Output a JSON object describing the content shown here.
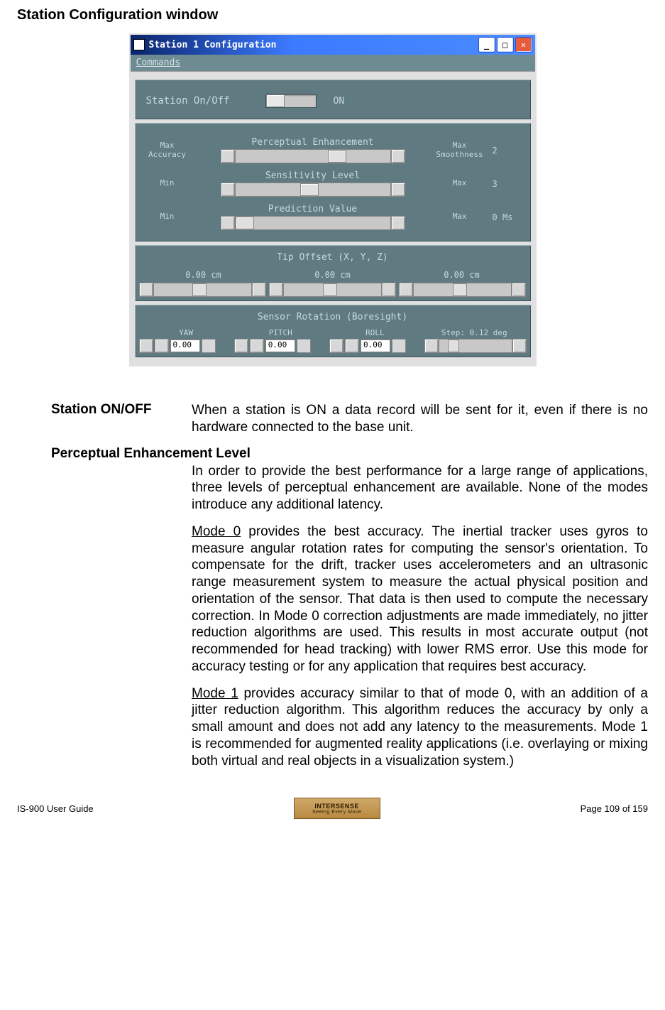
{
  "doc_heading": "Station Configuration window",
  "window": {
    "title": "Station 1 Configuration",
    "menu": {
      "commands": "Commands",
      "underline_char": "C"
    },
    "onoff": {
      "label": "Station On/Off",
      "state_text": "ON"
    },
    "sliders": {
      "perceptual": {
        "title": "Perceptual Enhancement",
        "left": "Max\nAccuracy",
        "right": "Max\nSmoothness",
        "value": "2",
        "thumb_pct": 60
      },
      "sensitivity": {
        "title": "Sensitivity Level",
        "left": "Min",
        "right": "Max",
        "value": "3",
        "thumb_pct": 42
      },
      "prediction": {
        "title": "Prediction Value",
        "left": "Min",
        "right": "Max",
        "value": "0 Ms",
        "thumb_pct": 0
      }
    },
    "tip": {
      "title": "Tip Offset (X, Y, Z)",
      "vals": [
        "0.00 cm",
        "0.00 cm",
        "0.00 cm"
      ]
    },
    "bore": {
      "title": "Sensor Rotation (Boresight)",
      "cols": [
        "YAW",
        "PITCH",
        "ROLL"
      ],
      "vals": [
        "0.00",
        "0.00",
        "0.00"
      ],
      "step_label": "Step: 0.12 deg"
    }
  },
  "descriptions": {
    "station_onoff": {
      "label": "Station ON/OFF",
      "text": "When a station is ON a data record will be sent for it, even if there is no hardware connected to the base unit."
    },
    "pel_heading": "Perceptual Enhancement Level",
    "pel_intro": "In order to provide the best performance for a large range of applications, three levels of perceptual enhancement are available.  None of the modes introduce any additional latency.",
    "mode0": {
      "head": "Mode 0",
      "text": " provides the best accuracy.  The inertial tracker uses gyros to measure angular rotation rates for computing the sensor's orientation.  To compensate for the drift, tracker uses accelerometers and an ultrasonic range measurement system to measure the actual physical position and orientation of the sensor.  That data is then used to compute the necessary correction.  In Mode 0 correction adjustments are made immediately, no jitter reduction algorithms are used.  This results in most accurate output (not recommended for head tracking) with lower RMS error.  Use this mode for accuracy testing or for any application that requires best accuracy."
    },
    "mode1": {
      "head": "Mode 1",
      "text": " provides accuracy similar to that of mode 0, with an addition of a jitter reduction algorithm.  This algorithm reduces the accuracy by only a small amount and does not add any latency to the measurements.  Mode 1 is recommended for augmented reality applications (i.e. overlaying or mixing both virtual and real objects in a visualization system.)"
    }
  },
  "footer": {
    "left": "IS-900 User Guide",
    "right": "Page 109 of 159",
    "logo_top": "INTERSENSE",
    "logo_bottom": "Seeing Every Move"
  }
}
